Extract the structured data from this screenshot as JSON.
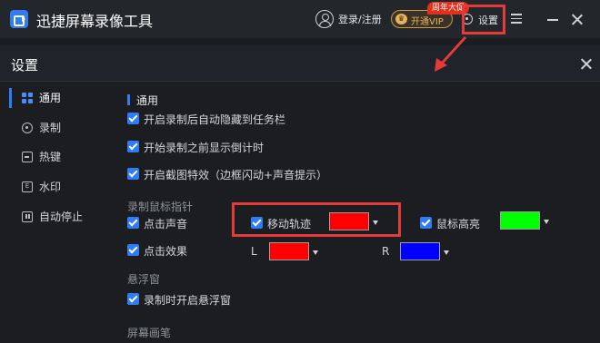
{
  "app": {
    "title": "迅捷屏幕录像工具",
    "login_label": "登录/注册",
    "vip_label": "开通VIP",
    "vip_badge": "周年大促",
    "settings_label": "设置"
  },
  "dialog": {
    "title": "设置"
  },
  "sidebar": {
    "items": [
      {
        "label": "通用",
        "icon": "grid-icon",
        "active": true
      },
      {
        "label": "录制",
        "icon": "record-circle-icon",
        "active": false
      },
      {
        "label": "热键",
        "icon": "keyboard-icon",
        "active": false
      },
      {
        "label": "水印",
        "icon": "watermark-icon",
        "active": false
      },
      {
        "label": "自动停止",
        "icon": "pause-icon",
        "active": false
      }
    ]
  },
  "general": {
    "title": "通用",
    "options": [
      {
        "label": "开启录制后自动隐藏到任务栏",
        "checked": true
      },
      {
        "label": "开始录制之前显示倒计时",
        "checked": true
      },
      {
        "label": "开启截图特效（边框闪动+声音提示）",
        "checked": true
      }
    ]
  },
  "mouse": {
    "title": "录制鼠标指针",
    "click_sound": {
      "label": "点击声音",
      "checked": true
    },
    "move_track": {
      "label": "移动轨迹",
      "checked": true,
      "color": "#ff0000"
    },
    "cursor_highlight": {
      "label": "鼠标高亮",
      "checked": true,
      "color": "#00ff00"
    },
    "click_effect": {
      "label": "点击效果",
      "checked": true
    },
    "left_label": "L",
    "left_color": "#ff0000",
    "right_label": "R",
    "right_color": "#0000ff"
  },
  "floating": {
    "title": "悬浮窗",
    "option": {
      "label": "录制时开启悬浮窗",
      "checked": true
    }
  },
  "screen_pen": {
    "title": "屏幕画笔"
  },
  "colors": {
    "accent": "#2f7cf6",
    "annotation_red": "#e53a3a",
    "vip_gold": "#e8b25a"
  }
}
